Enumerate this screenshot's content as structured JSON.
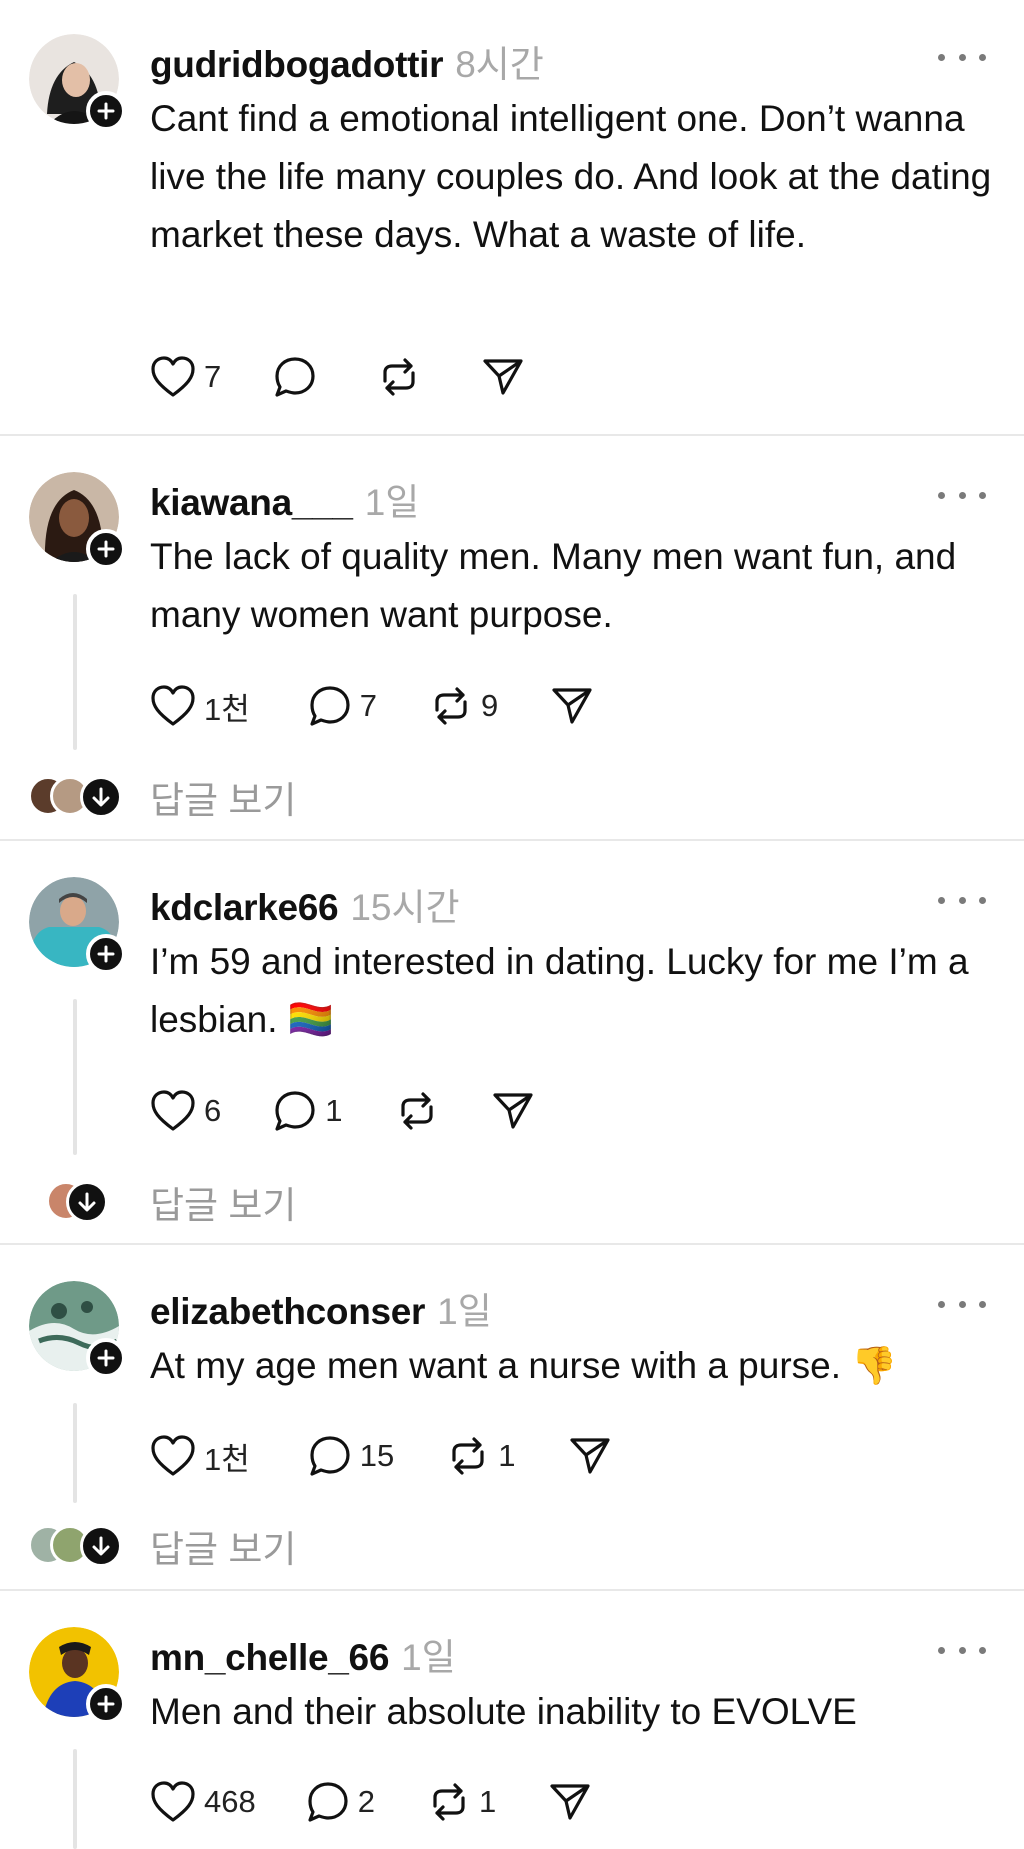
{
  "posts": [
    {
      "username": "gudridbogadottir",
      "time": "8시간",
      "text": "Cant find a emotional intelligent one. Don’t wanna live the life many couples do. And look at the dating market these days. What a waste of life.",
      "likes": "7",
      "replies": "",
      "reposts": "",
      "avatar_color": "#3a3a3a"
    },
    {
      "username": "kiawana___",
      "time": "1일",
      "text": "The lack of quality men. Many men want fun, and many women want purpose.",
      "likes": "1천",
      "replies": "7",
      "reposts": "9",
      "view_replies": "답글 보기",
      "avatar_color": "#6b4a36"
    },
    {
      "username": "kdclarke66",
      "time": "15시간",
      "text": "I’m 59 and interested in dating. Lucky for me I’m a lesbian. 🏳️‍🌈",
      "likes": "6",
      "replies": "1",
      "reposts": "",
      "view_replies": "답글 보기",
      "avatar_color": "#3fb8c2"
    },
    {
      "username": "elizabethconser",
      "time": "1일",
      "text": "At my age men want a nurse with a purse. 👎",
      "likes": "1천",
      "replies": "15",
      "reposts": "1",
      "view_replies": "답글 보기",
      "avatar_color": "#4e7f6a"
    },
    {
      "username": "mn_chelle_66",
      "time": "1일",
      "text": "Men and their absolute inability to EVOLVE",
      "likes": "468",
      "replies": "2",
      "reposts": "1",
      "avatar_color": "#f2c200"
    }
  ]
}
